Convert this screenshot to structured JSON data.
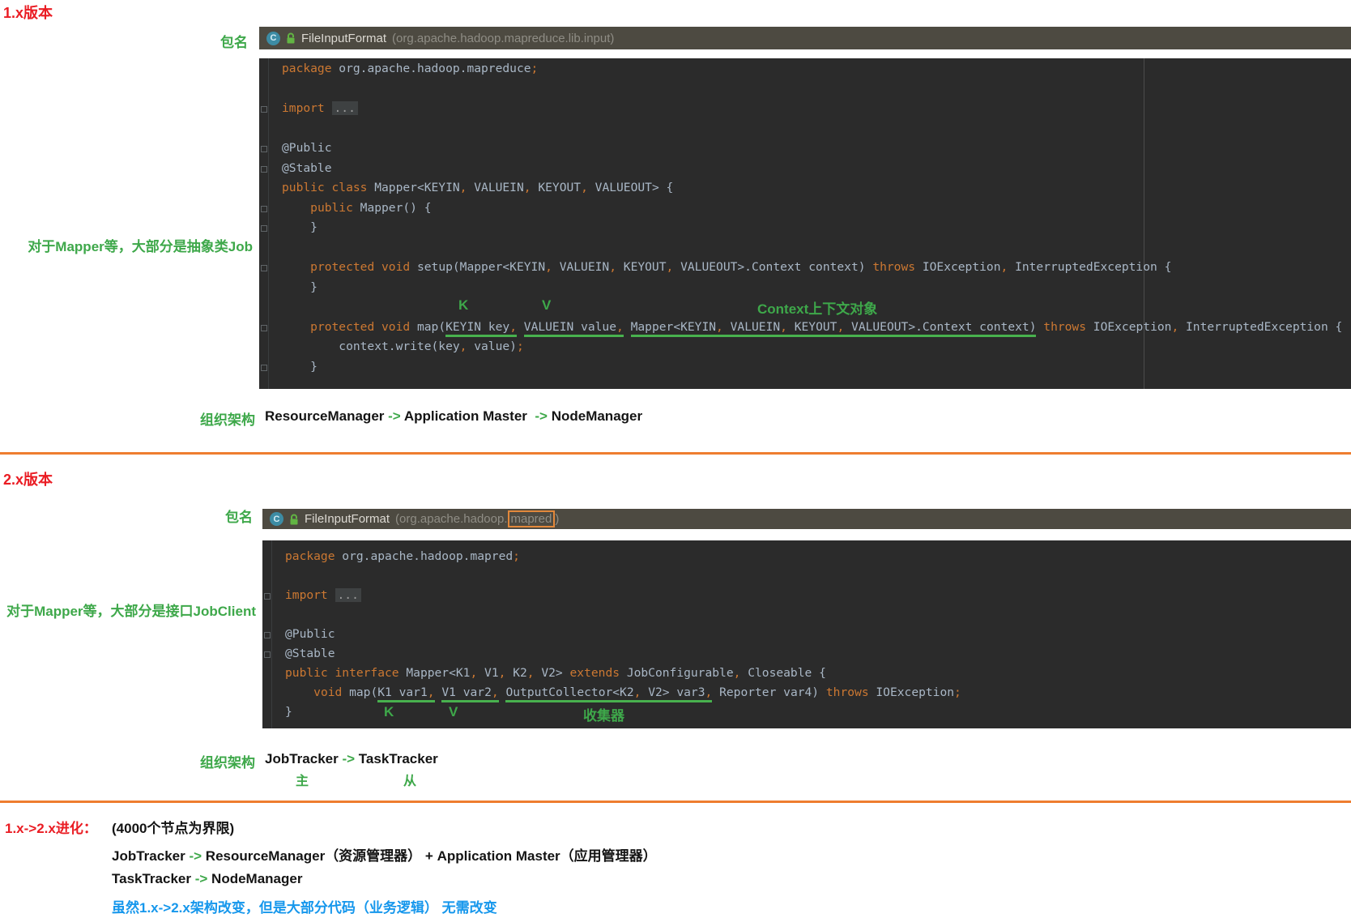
{
  "colors": {
    "accent_red": "#ea1c23",
    "accent_green": "#3ea84a",
    "underline_green": "#48b14e",
    "divider_orange": "#ee7d2f",
    "link_blue": "#1697ec",
    "keyword_orange": "#cc7832",
    "code_fg": "#a9b7c6",
    "code_bg": "#2b2b2b",
    "header_bg": "#4d4a41",
    "highlight_box_orange": "#e2883b",
    "lock_green": "#62b543",
    "class_icon_teal": "#3d8ca4"
  },
  "section1": {
    "heading": "1.x版本",
    "package_label": "包名",
    "header": {
      "icon": "C",
      "title": "FileInputFormat",
      "path": "(org.apache.hadoop.mapreduce.lib.input)"
    },
    "side_note": "对于Mapper等，大部分是抽象类Job",
    "overlay_labels": {
      "k": "K",
      "v": "V",
      "context": "Context上下文对象"
    },
    "architecture": {
      "label": "组织架构",
      "node1": "ResourceManager",
      "arrow1": "->",
      "node2": "Application Master",
      "arrow2": "->",
      "node3": "NodeManager"
    }
  },
  "section2": {
    "heading": "2.x版本",
    "package_label": "包名",
    "header": {
      "icon": "C",
      "title": "FileInputFormat",
      "path_prefix": "(org.apache.hadoop.",
      "path_highlight": "mapred",
      "path_suffix": ")"
    },
    "side_note": "对于Mapper等，大部分是接口JobClient",
    "overlay_labels": {
      "k": "K",
      "v": "V",
      "collector": "收集器"
    },
    "architecture": {
      "label": "组织架构",
      "node1": "JobTracker",
      "arrow1": "->",
      "node2": "TaskTracker",
      "master": "主",
      "slave": "从"
    }
  },
  "section3": {
    "heading": "1.x->2.x进化：",
    "note": "(4000个节点为界限)",
    "line1": {
      "from": "JobTracker",
      "arrow": "->",
      "to": "ResourceManager（资源管理器）",
      "plus": "+",
      "extra": "Application Master（应用管理器）"
    },
    "line2": {
      "from": "TaskTracker",
      "arrow": "->",
      "to": "NodeManager"
    },
    "conclusion": "虽然1.x->2.x架构改变，但是大部分代码（业务逻辑） 无需改变"
  },
  "code_blocks": [
    {
      "id": "code1",
      "lines": [
        {
          "toks": [
            {
              "t": "kw",
              "s": "package"
            },
            {
              "t": "pl",
              "s": " org.apache.hadoop.mapreduce"
            },
            {
              "t": "kw",
              "s": ";"
            }
          ]
        },
        {
          "toks": []
        },
        {
          "m": 1,
          "toks": [
            {
              "t": "kw",
              "s": "import"
            },
            {
              "t": "pl",
              "s": " "
            },
            {
              "t": "fold",
              "s": "..."
            }
          ]
        },
        {
          "toks": []
        },
        {
          "m": 1,
          "toks": [
            {
              "t": "pl",
              "s": "@Public"
            }
          ]
        },
        {
          "m": 1,
          "toks": [
            {
              "t": "pl",
              "s": "@Stable"
            }
          ]
        },
        {
          "toks": [
            {
              "t": "kw",
              "s": "public class"
            },
            {
              "t": "pl",
              "s": " Mapper<KEYIN"
            },
            {
              "t": "kw",
              "s": ","
            },
            {
              "t": "pl",
              "s": " VALUEIN"
            },
            {
              "t": "kw",
              "s": ","
            },
            {
              "t": "pl",
              "s": " KEYOUT"
            },
            {
              "t": "kw",
              "s": ","
            },
            {
              "t": "pl",
              "s": " VALUEOUT> {"
            }
          ]
        },
        {
          "m": 1,
          "toks": [
            {
              "t": "pl",
              "s": "    "
            },
            {
              "t": "kw",
              "s": "public"
            },
            {
              "t": "pl",
              "s": " Mapper() {"
            }
          ]
        },
        {
          "m": 1,
          "toks": [
            {
              "t": "pl",
              "s": "    }"
            }
          ]
        },
        {
          "toks": []
        },
        {
          "m": 1,
          "toks": [
            {
              "t": "pl",
              "s": "    "
            },
            {
              "t": "kw",
              "s": "protected void"
            },
            {
              "t": "pl",
              "s": " setup(Mapper<KEYIN"
            },
            {
              "t": "kw",
              "s": ","
            },
            {
              "t": "pl",
              "s": " VALUEIN"
            },
            {
              "t": "kw",
              "s": ","
            },
            {
              "t": "pl",
              "s": " KEYOUT"
            },
            {
              "t": "kw",
              "s": ","
            },
            {
              "t": "pl",
              "s": " VALUEOUT>.Context context) "
            },
            {
              "t": "kw",
              "s": "throws"
            },
            {
              "t": "pl",
              "s": " IOException"
            },
            {
              "t": "kw",
              "s": ","
            },
            {
              "t": "pl",
              "s": " InterruptedException {"
            }
          ]
        },
        {
          "toks": [
            {
              "t": "pl",
              "s": "    }"
            }
          ]
        },
        {
          "toks": []
        },
        {
          "m": 1,
          "toks": [
            {
              "t": "pl",
              "s": "    "
            },
            {
              "t": "kw",
              "s": "protected void"
            },
            {
              "t": "pl",
              "s": " map("
            },
            {
              "t": "u",
              "s": "KEYIN key"
            },
            {
              "t": "uk",
              "s": ","
            },
            {
              "t": "pl",
              "s": " "
            },
            {
              "t": "u",
              "s": "VALUEIN value"
            },
            {
              "t": "uk",
              "s": ","
            },
            {
              "t": "pl",
              "s": " "
            },
            {
              "t": "u",
              "s": "Mapper<KEYIN"
            },
            {
              "t": "uk",
              "s": ","
            },
            {
              "t": "u",
              "s": " VALUEIN"
            },
            {
              "t": "uk",
              "s": ","
            },
            {
              "t": "u",
              "s": " KEYOUT"
            },
            {
              "t": "uk",
              "s": ","
            },
            {
              "t": "u",
              "s": " VALUEOUT>.Context context)"
            },
            {
              "t": "pl",
              "s": " "
            },
            {
              "t": "kw",
              "s": "throws"
            },
            {
              "t": "pl",
              "s": " IOException"
            },
            {
              "t": "kw",
              "s": ","
            },
            {
              "t": "pl",
              "s": " InterruptedException {"
            }
          ]
        },
        {
          "toks": [
            {
              "t": "pl",
              "s": "        context.write(key"
            },
            {
              "t": "kw",
              "s": ","
            },
            {
              "t": "pl",
              "s": " value)"
            },
            {
              "t": "kw",
              "s": ";"
            }
          ]
        },
        {
          "m": 1,
          "toks": [
            {
              "t": "pl",
              "s": "    }"
            }
          ]
        }
      ]
    },
    {
      "id": "code2",
      "lines": [
        {
          "toks": [
            {
              "t": "kw",
              "s": "package"
            },
            {
              "t": "pl",
              "s": " org.apache.hadoop.mapred"
            },
            {
              "t": "kw",
              "s": ";"
            }
          ]
        },
        {
          "toks": []
        },
        {
          "m": 1,
          "toks": [
            {
              "t": "kw",
              "s": "import"
            },
            {
              "t": "pl",
              "s": " "
            },
            {
              "t": "fold",
              "s": "..."
            }
          ]
        },
        {
          "toks": []
        },
        {
          "m": 1,
          "toks": [
            {
              "t": "pl",
              "s": "@Public"
            }
          ]
        },
        {
          "m": 1,
          "toks": [
            {
              "t": "pl",
              "s": "@Stable"
            }
          ]
        },
        {
          "toks": [
            {
              "t": "kw",
              "s": "public interface"
            },
            {
              "t": "pl",
              "s": " Mapper<K1"
            },
            {
              "t": "kw",
              "s": ","
            },
            {
              "t": "pl",
              "s": " V1"
            },
            {
              "t": "kw",
              "s": ","
            },
            {
              "t": "pl",
              "s": " K2"
            },
            {
              "t": "kw",
              "s": ","
            },
            {
              "t": "pl",
              "s": " V2> "
            },
            {
              "t": "kw",
              "s": "extends"
            },
            {
              "t": "pl",
              "s": " JobConfigurable"
            },
            {
              "t": "kw",
              "s": ","
            },
            {
              "t": "pl",
              "s": " Closeable {"
            }
          ]
        },
        {
          "toks": [
            {
              "t": "pl",
              "s": "    "
            },
            {
              "t": "kw",
              "s": "void"
            },
            {
              "t": "pl",
              "s": " map("
            },
            {
              "t": "u",
              "s": "K1 var1"
            },
            {
              "t": "uk",
              "s": ","
            },
            {
              "t": "pl",
              "s": " "
            },
            {
              "t": "u",
              "s": "V1 var2"
            },
            {
              "t": "uk",
              "s": ","
            },
            {
              "t": "pl",
              "s": " "
            },
            {
              "t": "u",
              "s": "OutputCollector<K2"
            },
            {
              "t": "uk",
              "s": ","
            },
            {
              "t": "u",
              "s": " V2> var3"
            },
            {
              "t": "uk",
              "s": ","
            },
            {
              "t": "pl",
              "s": " Reporter var4) "
            },
            {
              "t": "kw",
              "s": "throws"
            },
            {
              "t": "pl",
              "s": " IOException"
            },
            {
              "t": "kw",
              "s": ";"
            }
          ]
        },
        {
          "toks": [
            {
              "t": "pl",
              "s": "}"
            }
          ]
        }
      ]
    }
  ]
}
